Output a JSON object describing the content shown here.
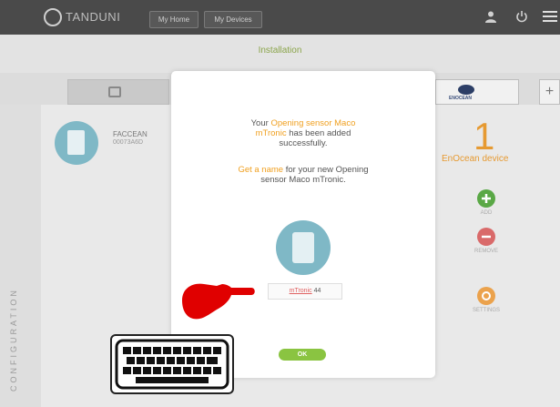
{
  "topbar": {
    "logo_text": "TANDUNI",
    "btn1": "My Home",
    "btn2": "My Devices"
  },
  "header": {
    "title": "Installation"
  },
  "tabs": {
    "plus": "+",
    "enocean_label": "ENOCEAN"
  },
  "device": {
    "name": "FACCEAN",
    "id": "00073A6D"
  },
  "summary": {
    "count": "1",
    "label": "EnOcean device"
  },
  "actions": {
    "add": "ADD",
    "remove": "REMOVE",
    "settings": "SETTINGS"
  },
  "sidebar": {
    "label": "CONFIGURATION"
  },
  "modal": {
    "line1_prefix": "Your ",
    "line1_highlight": "Opening sensor Maco",
    "line2_highlight": "mTronic",
    "line2_suffix": " has been added",
    "line3": "successfully.",
    "line4_highlight": "Get a name",
    "line4_suffix": " for your new Opening",
    "line5": "sensor Maco mTronic.",
    "name_link": "mTronic",
    "name_suffix": " 44",
    "ok": "OK"
  },
  "colors": {
    "accent_orange": "#f0a020",
    "ok_green": "#8ac441",
    "device_teal": "#7fb8c6",
    "arrow_red": "#e00000"
  },
  "icons": [
    "user-icon",
    "power-icon",
    "menu-icon",
    "monitor-icon",
    "enocean-icon",
    "add-icon",
    "remove-icon",
    "settings-icon",
    "keyboard-icon",
    "pointing-hand-icon"
  ]
}
